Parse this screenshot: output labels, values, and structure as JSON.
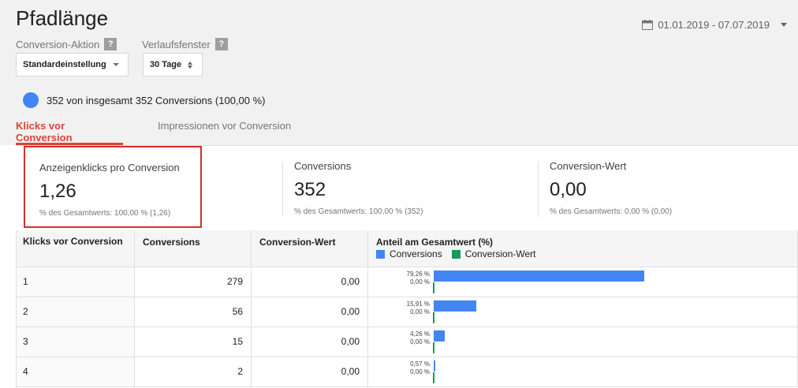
{
  "header": {
    "title": "Pfadlänge",
    "date_range": "01.01.2019 - 07.07.2019",
    "conversion_action_label": "Conversion-Aktion",
    "conversion_action_value": "Standardeinstellung",
    "lookback_label": "Verlaufsfenster",
    "lookback_value": "30 Tage",
    "help_glyph": "?",
    "summary_text": "352 von insgesamt 352 Conversions (100,00 %)"
  },
  "tabs": [
    {
      "label": "Klicks vor Conversion",
      "active": true
    },
    {
      "label": "Impressionen vor Conversion",
      "active": false
    }
  ],
  "metrics": [
    {
      "label": "Anzeigenklicks pro Conversion",
      "value": "1,26",
      "sub": "% des Gesamtwerts: 100,00 % (1,26)"
    },
    {
      "label": "Conversions",
      "value": "352",
      "sub": "% des Gesamtwerts: 100,00 % (352)"
    },
    {
      "label": "Conversion-Wert",
      "value": "0,00",
      "sub": "% des Gesamtwerts: 0,00 % (0,00)"
    }
  ],
  "table": {
    "headers": [
      "Klicks vor Conversion",
      "Conversions",
      "Conversion-Wert",
      "Anteil am Gesamtwert (%)"
    ],
    "legend": [
      {
        "name": "Conversions",
        "color": "#4285f4"
      },
      {
        "name": "Conversion-Wert",
        "color": "#0f9d58"
      }
    ],
    "rows": [
      {
        "clicks": "1",
        "conversions": "279",
        "value": "0,00",
        "conv_pct_label": "79,26 %",
        "value_pct_label": "0,00 %",
        "conv_share": 79.26
      },
      {
        "clicks": "2",
        "conversions": "56",
        "value": "0,00",
        "conv_pct_label": "15,91 %",
        "value_pct_label": "0,00 %",
        "conv_share": 15.91
      },
      {
        "clicks": "3",
        "conversions": "15",
        "value": "0,00",
        "conv_pct_label": "4,26 %",
        "value_pct_label": "0,00 %",
        "conv_share": 4.26
      },
      {
        "clicks": "4",
        "conversions": "2",
        "value": "0,00",
        "conv_pct_label": "0,57 %",
        "value_pct_label": "0,00 %",
        "conv_share": 0.57
      }
    ]
  },
  "colors": {
    "accent": "#db4437",
    "conversions": "#4285f4",
    "conversion_value": "#0f9d58",
    "highlight_border": "#d32f2f"
  },
  "icons": {
    "date": "calendar-icon",
    "help": "help-icon",
    "dropdown": "chevron-down-icon",
    "stepper": "stepper-icon"
  }
}
